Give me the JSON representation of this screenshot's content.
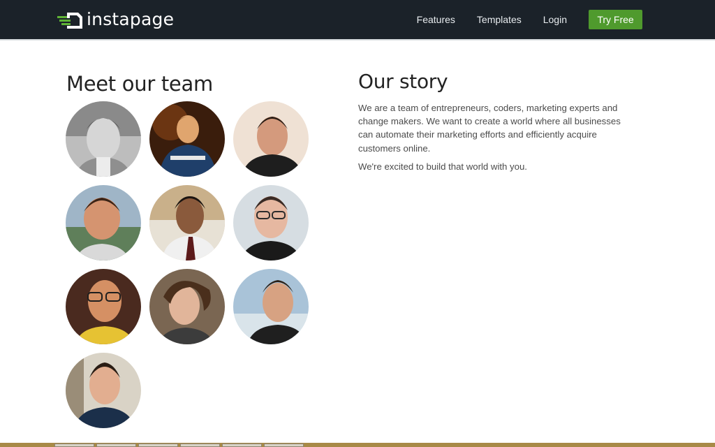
{
  "brand": {
    "name": "instapage",
    "accent": "#4f9a2d",
    "nav_bg": "#1b2229"
  },
  "nav": {
    "links": [
      "Features",
      "Templates",
      "Login"
    ],
    "cta": "Try Free"
  },
  "team": {
    "title": "Meet our team",
    "members": [
      {
        "photo": "grayscale-portrait"
      },
      {
        "photo": "dark-blue-shirt-portrait"
      },
      {
        "photo": "black-tshirt-portrait"
      },
      {
        "photo": "outdoor-smiling-portrait"
      },
      {
        "photo": "white-shirt-tie-portrait"
      },
      {
        "photo": "glasses-portrait"
      },
      {
        "photo": "glasses-yellow-shirt-portrait"
      },
      {
        "photo": "curly-hair-portrait"
      },
      {
        "photo": "winter-outdoor-portrait"
      },
      {
        "photo": "hoodie-portrait"
      }
    ]
  },
  "story": {
    "title": "Our story",
    "paragraphs": [
      "We are a team of entrepreneurs, coders, marketing experts and change makers. We want to create a world where all businesses can automate their marketing efforts and efficiently acquire customers online.",
      "We're excited to build that world with you."
    ]
  }
}
